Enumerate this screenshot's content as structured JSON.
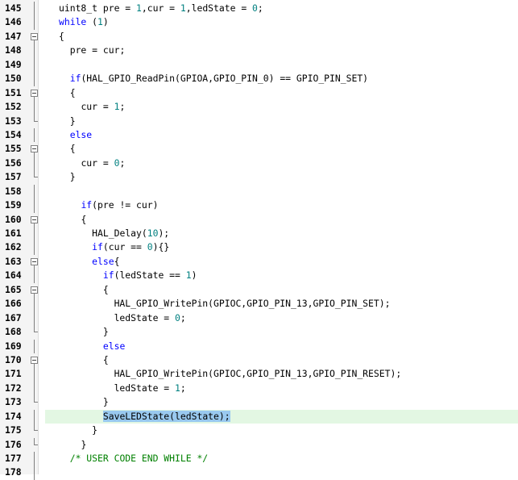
{
  "editor": {
    "highlight_line": "174",
    "lines": [
      {
        "n": "145",
        "fold": "vline",
        "indent": "",
        "tokens": [
          {
            "t": "uint8_t pre = ",
            "c": ""
          },
          {
            "t": "1",
            "c": "num"
          },
          {
            "t": ",cur = ",
            "c": ""
          },
          {
            "t": "1",
            "c": "num"
          },
          {
            "t": ",ledState = ",
            "c": ""
          },
          {
            "t": "0",
            "c": "num"
          },
          {
            "t": ";",
            "c": ""
          }
        ]
      },
      {
        "n": "146",
        "fold": "vline",
        "indent": "",
        "tokens": [
          {
            "t": "while",
            "c": "kw"
          },
          {
            "t": " (",
            "c": ""
          },
          {
            "t": "1",
            "c": "num"
          },
          {
            "t": ")",
            "c": ""
          }
        ]
      },
      {
        "n": "147",
        "fold": "start",
        "indent": "",
        "tokens": [
          {
            "t": "{",
            "c": ""
          }
        ]
      },
      {
        "n": "148",
        "fold": "vline",
        "indent": "  ",
        "tokens": [
          {
            "t": "pre = cur;",
            "c": ""
          }
        ]
      },
      {
        "n": "149",
        "fold": "vline",
        "indent": "",
        "tokens": []
      },
      {
        "n": "150",
        "fold": "vline",
        "indent": "  ",
        "tokens": [
          {
            "t": "if",
            "c": "kw"
          },
          {
            "t": "(HAL_GPIO_ReadPin(GPIOA,GPIO_PIN_0) == GPIO_PIN_SET)",
            "c": ""
          }
        ]
      },
      {
        "n": "151",
        "fold": "start",
        "indent": "  ",
        "tokens": [
          {
            "t": "{",
            "c": ""
          }
        ]
      },
      {
        "n": "152",
        "fold": "vline",
        "indent": "    ",
        "tokens": [
          {
            "t": "cur = ",
            "c": ""
          },
          {
            "t": "1",
            "c": "num"
          },
          {
            "t": ";",
            "c": ""
          }
        ]
      },
      {
        "n": "153",
        "fold": "end",
        "indent": "  ",
        "tokens": [
          {
            "t": "}",
            "c": ""
          }
        ]
      },
      {
        "n": "154",
        "fold": "vline",
        "indent": "  ",
        "tokens": [
          {
            "t": "else",
            "c": "kw"
          }
        ]
      },
      {
        "n": "155",
        "fold": "start",
        "indent": "  ",
        "tokens": [
          {
            "t": "{",
            "c": ""
          }
        ]
      },
      {
        "n": "156",
        "fold": "vline",
        "indent": "    ",
        "tokens": [
          {
            "t": "cur = ",
            "c": ""
          },
          {
            "t": "0",
            "c": "num"
          },
          {
            "t": ";",
            "c": ""
          }
        ]
      },
      {
        "n": "157",
        "fold": "end",
        "indent": "  ",
        "tokens": [
          {
            "t": "}",
            "c": ""
          }
        ]
      },
      {
        "n": "158",
        "fold": "vline",
        "indent": "",
        "tokens": []
      },
      {
        "n": "159",
        "fold": "vline",
        "indent": "    ",
        "tokens": [
          {
            "t": "if",
            "c": "kw"
          },
          {
            "t": "(pre != cur)",
            "c": ""
          }
        ]
      },
      {
        "n": "160",
        "fold": "start",
        "indent": "    ",
        "tokens": [
          {
            "t": "{",
            "c": ""
          }
        ]
      },
      {
        "n": "161",
        "fold": "vline",
        "indent": "      ",
        "tokens": [
          {
            "t": "HAL_Delay(",
            "c": ""
          },
          {
            "t": "10",
            "c": "num"
          },
          {
            "t": ");",
            "c": ""
          }
        ]
      },
      {
        "n": "162",
        "fold": "vline",
        "indent": "      ",
        "tokens": [
          {
            "t": "if",
            "c": "kw"
          },
          {
            "t": "(cur == ",
            "c": ""
          },
          {
            "t": "0",
            "c": "num"
          },
          {
            "t": "){}",
            "c": ""
          }
        ]
      },
      {
        "n": "163",
        "fold": "start",
        "indent": "      ",
        "tokens": [
          {
            "t": "else",
            "c": "kw"
          },
          {
            "t": "{",
            "c": ""
          }
        ]
      },
      {
        "n": "164",
        "fold": "vline",
        "indent": "        ",
        "tokens": [
          {
            "t": "if",
            "c": "kw"
          },
          {
            "t": "(ledState == ",
            "c": ""
          },
          {
            "t": "1",
            "c": "num"
          },
          {
            "t": ")",
            "c": ""
          }
        ]
      },
      {
        "n": "165",
        "fold": "start",
        "indent": "        ",
        "tokens": [
          {
            "t": "{",
            "c": ""
          }
        ]
      },
      {
        "n": "166",
        "fold": "vline",
        "indent": "          ",
        "tokens": [
          {
            "t": "HAL_GPIO_WritePin(GPIOC,GPIO_PIN_13,GPIO_PIN_SET);",
            "c": ""
          }
        ]
      },
      {
        "n": "167",
        "fold": "vline",
        "indent": "          ",
        "tokens": [
          {
            "t": "ledState = ",
            "c": ""
          },
          {
            "t": "0",
            "c": "num"
          },
          {
            "t": ";",
            "c": ""
          }
        ]
      },
      {
        "n": "168",
        "fold": "end",
        "indent": "        ",
        "tokens": [
          {
            "t": "}",
            "c": ""
          }
        ]
      },
      {
        "n": "169",
        "fold": "vline",
        "indent": "        ",
        "tokens": [
          {
            "t": "else",
            "c": "kw"
          }
        ]
      },
      {
        "n": "170",
        "fold": "start",
        "indent": "        ",
        "tokens": [
          {
            "t": "{",
            "c": ""
          }
        ]
      },
      {
        "n": "171",
        "fold": "vline",
        "indent": "          ",
        "tokens": [
          {
            "t": "HAL_GPIO_WritePin(GPIOC,GPIO_PIN_13,GPIO_PIN_RESET);",
            "c": ""
          }
        ]
      },
      {
        "n": "172",
        "fold": "vline",
        "indent": "          ",
        "tokens": [
          {
            "t": "ledState = ",
            "c": ""
          },
          {
            "t": "1",
            "c": "num"
          },
          {
            "t": ";",
            "c": ""
          }
        ]
      },
      {
        "n": "173",
        "fold": "end",
        "indent": "        ",
        "tokens": [
          {
            "t": "}",
            "c": ""
          }
        ]
      },
      {
        "n": "174",
        "fold": "vline",
        "indent": "        ",
        "tokens": [
          {
            "t": "SaveLEDState(ledState);",
            "c": "sel"
          }
        ]
      },
      {
        "n": "175",
        "fold": "end",
        "indent": "      ",
        "tokens": [
          {
            "t": "}",
            "c": ""
          }
        ]
      },
      {
        "n": "176",
        "fold": "end",
        "indent": "    ",
        "tokens": [
          {
            "t": "}",
            "c": ""
          }
        ]
      },
      {
        "n": "177",
        "fold": "vline",
        "indent": "  ",
        "tokens": [
          {
            "t": "/* USER CODE END WHILE */",
            "c": "cmt"
          }
        ]
      },
      {
        "n": "178",
        "fold": "vline",
        "indent": "",
        "tokens": []
      }
    ]
  }
}
